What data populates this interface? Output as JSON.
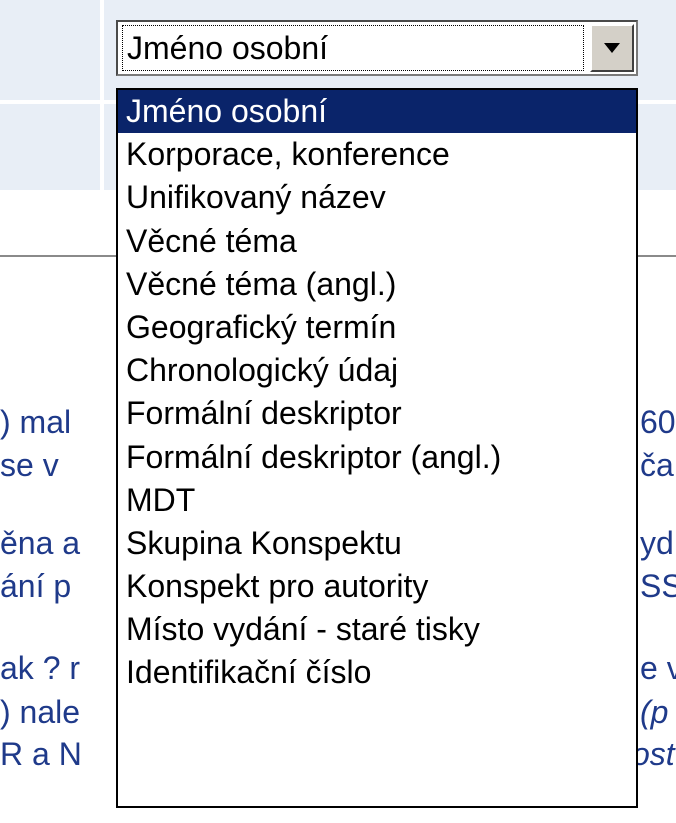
{
  "select": {
    "value": "Jméno osobní",
    "options": [
      "Jméno osobní",
      "Korporace, konference",
      "Unifikovaný název",
      "Věcné téma",
      "Věcné téma (angl.)",
      "Geografický termín",
      "Chronologický údaj",
      "Formální deskriptor",
      "Formální deskriptor (angl.)",
      "MDT",
      "Skupina Konspektu",
      "Konspekt pro autority",
      "Místo vydání - staré tisky",
      "Identifikační číslo"
    ],
    "highlighted_index": 0
  },
  "background_text": {
    "line1": {
      "left": ") mal",
      "right": "60"
    },
    "line2": {
      "left": " se v",
      "right": "ča"
    },
    "line3": {
      "left": "ěna a",
      "right": "yd"
    },
    "line4": {
      "left": "ání p",
      "right": "SS"
    },
    "line5": {
      "left": "ak ? r",
      "right": "e v"
    },
    "line6": {
      "left": ") nale",
      "right": "(p"
    },
    "line7": {
      "left": "R a N",
      "right": "ost"
    }
  },
  "colors": {
    "highlight": "#0a246a",
    "link_text": "#1f3a8a",
    "panel_bg": "#e8eef6"
  }
}
